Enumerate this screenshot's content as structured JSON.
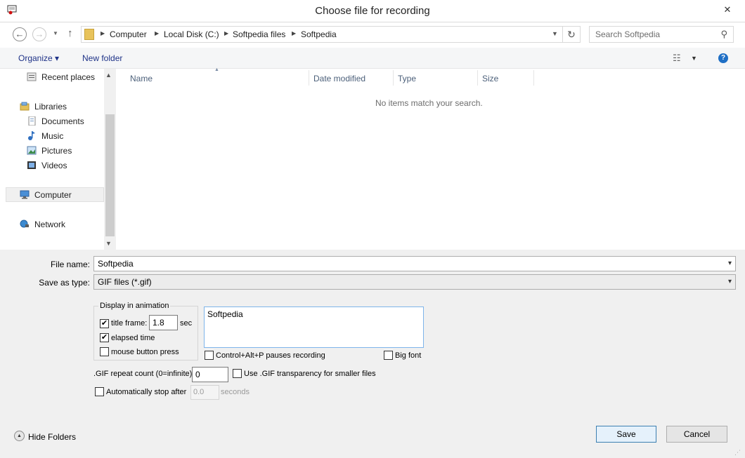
{
  "window": {
    "title": "Choose file for recording",
    "close_glyph": "✕"
  },
  "nav": {
    "back_glyph": "←",
    "forward_glyph": "→",
    "up_glyph": "↑",
    "refresh_glyph": "↻",
    "breadcrumbs": [
      "Computer",
      "Local Disk (C:)",
      "Softpedia files",
      "Softpedia"
    ],
    "search_placeholder": "Search Softpedia"
  },
  "commands": {
    "organize": "Organize ▾",
    "new_folder": "New folder"
  },
  "sidebar": {
    "items": [
      {
        "label": "Recent places",
        "icon": "recent-places-icon"
      },
      {
        "label": "Libraries",
        "icon": "libraries-icon"
      },
      {
        "label": "Documents",
        "icon": "documents-icon"
      },
      {
        "label": "Music",
        "icon": "music-icon"
      },
      {
        "label": "Pictures",
        "icon": "pictures-icon"
      },
      {
        "label": "Videos",
        "icon": "videos-icon"
      },
      {
        "label": "Computer",
        "icon": "computer-icon"
      },
      {
        "label": "Network",
        "icon": "network-icon"
      }
    ]
  },
  "file_list": {
    "columns": [
      "Name",
      "Date modified",
      "Type",
      "Size"
    ],
    "empty_message": "No items match your search."
  },
  "form": {
    "file_name_label": "File name:",
    "file_name_value": "Softpedia",
    "save_type_label": "Save as type:",
    "save_type_value": "GIF files (*.gif)"
  },
  "options": {
    "group_title": "Display in animation",
    "title_frame_label": "title frame:",
    "title_frame_checked": true,
    "title_frame_seconds": "1.8",
    "sec_label": "sec",
    "elapsed_label": "elapsed time",
    "elapsed_checked": true,
    "mouse_label": "mouse button press",
    "mouse_checked": false,
    "title_text": "Softpedia",
    "pause_label": "Control+Alt+P pauses recording",
    "big_font_label": "Big font",
    "repeat_label": ".GIF repeat count (0=infinite):",
    "repeat_value": "0",
    "transparency_label": "Use .GIF transparency for smaller files",
    "autostop_label": "Automatically stop after",
    "autostop_value": "0.0",
    "seconds_label": "seconds"
  },
  "footer": {
    "hide_folders": "Hide Folders",
    "save": "Save",
    "cancel": "Cancel"
  }
}
